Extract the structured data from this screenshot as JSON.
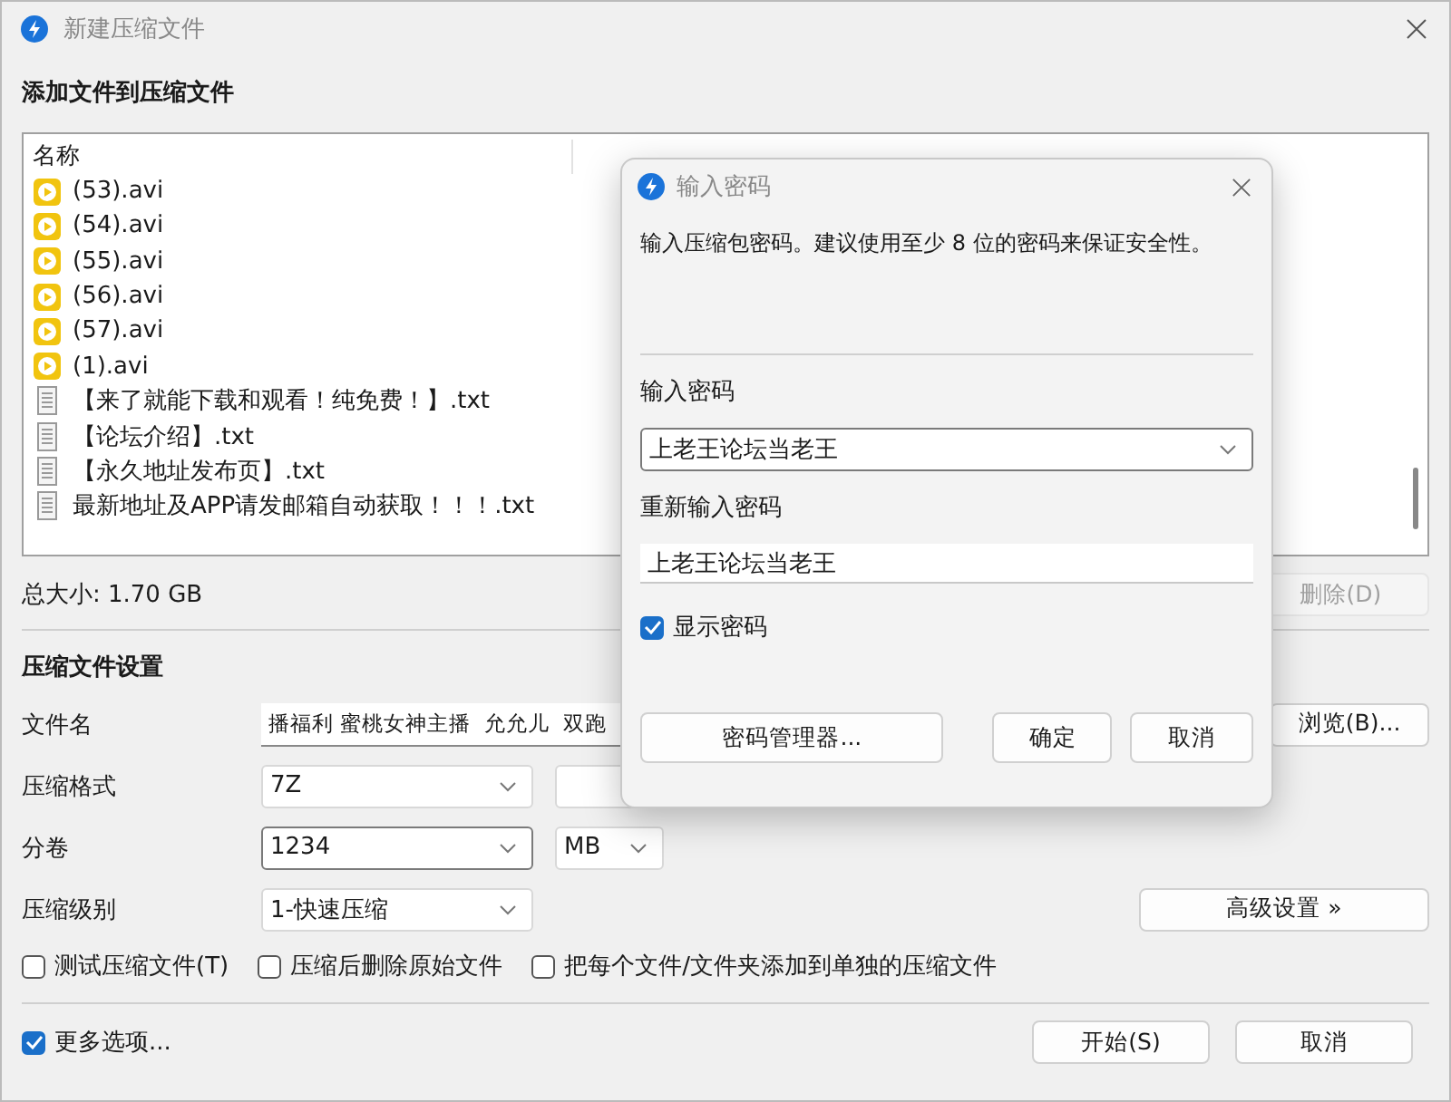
{
  "window": {
    "title": "新建压缩文件"
  },
  "files": {
    "heading": "添加文件到压缩文件",
    "columns": [
      "名称"
    ],
    "rows": [
      {
        "name": "(53).avi",
        "kind": "video"
      },
      {
        "name": "(54).avi",
        "kind": "video"
      },
      {
        "name": "(55).avi",
        "kind": "video"
      },
      {
        "name": "(56).avi",
        "kind": "video"
      },
      {
        "name": "(57).avi",
        "kind": "video"
      },
      {
        "name": "(1).avi",
        "kind": "video"
      },
      {
        "name": "【来了就能下载和观看！纯免费！】.txt",
        "kind": "document"
      },
      {
        "name": "【论坛介绍】.txt",
        "kind": "document"
      },
      {
        "name": "【永久地址发布页】.txt",
        "kind": "document"
      },
      {
        "name": "最新地址及APP请发邮箱自动获取！！！.txt",
        "kind": "document"
      }
    ],
    "total": "总大小: 1.70 GB",
    "delete_button": {
      "label": "删除(D)",
      "disabled": true
    }
  },
  "settings": {
    "heading": "压缩文件设置",
    "filename": {
      "label": "文件名",
      "value": "播福利 蜜桃女神主播  允允儿  双跑",
      "button": "浏览(B)..."
    },
    "format": {
      "label": "压缩格式",
      "value": "7Z"
    },
    "volume": {
      "label": "分卷",
      "value": "1234",
      "unit": "MB"
    },
    "level": {
      "label": "压缩级别",
      "value": "1-快速压缩",
      "button": "高级设置 »"
    },
    "options": [
      {
        "label": "测试压缩文件(T)",
        "checked": false
      },
      {
        "label": "压缩后删除原始文件",
        "checked": false
      },
      {
        "label": "把每个文件/文件夹添加到单独的压缩文件",
        "checked": false
      }
    ]
  },
  "footer": {
    "more_options": {
      "label": "更多选项...",
      "checked": true
    },
    "buttons": [
      "开始(S)",
      "取消"
    ]
  },
  "dialog": {
    "title": "输入密码",
    "description": "输入压缩包密码。建议使用至少 8 位的密码来保证安全性。",
    "password_label": "输入密码",
    "password": "上老王论坛当老王",
    "confirm_label": "重新输入密码",
    "confirm": "上老王论坛当老王",
    "show_password": {
      "label": "显示密码",
      "checked": true
    },
    "buttons": [
      "密码管理器...",
      "确定",
      "取消"
    ]
  }
}
